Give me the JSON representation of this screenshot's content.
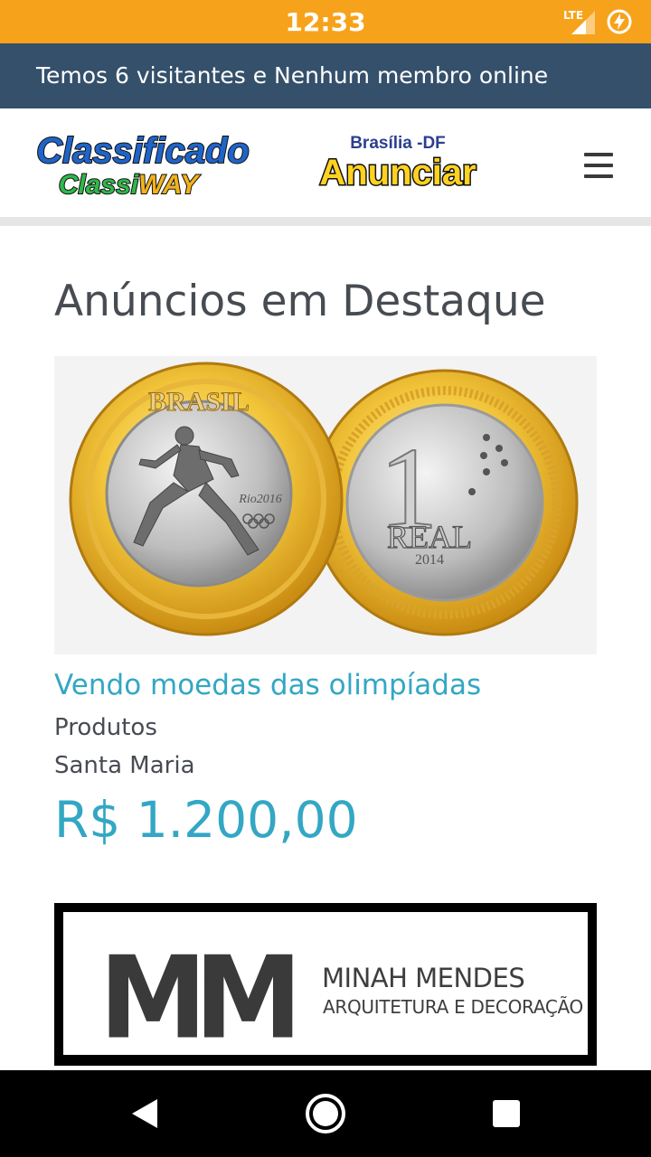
{
  "status_bar": {
    "time": "12:33",
    "network": "LTE",
    "icons": [
      "lte-signal-icon",
      "battery-charging-icon"
    ],
    "color": "#f7a21b"
  },
  "visitors": {
    "text": "Temos 6 visitantes e Nenhum membro online",
    "color": "#34506b"
  },
  "header": {
    "logo_line1": "Classificado",
    "logo_line2_a": "Classi",
    "logo_line2_b": "WAY",
    "anunciar_subtitle": "Brasília -DF",
    "anunciar_label": "Anunciar",
    "menu_icon": "hamburger-menu-icon"
  },
  "main": {
    "section_title": "Anúncios em Destaque",
    "ad": {
      "title": "Vendo moedas das olimpíadas",
      "category": "Produtos",
      "location": "Santa Maria",
      "price": "R$ 1.200,00",
      "image": {
        "coin_left_text": "BRASIL",
        "coin_left_logo": "Rio2016",
        "coin_right_value": "1",
        "coin_right_text": "REAL",
        "coin_right_year": "2014"
      }
    }
  },
  "sponsor": {
    "monogram": "MM",
    "name": "MINAH MENDES",
    "tagline": "ARQUITETURA E DECORAÇÃO"
  },
  "nav_bar": {
    "icons": [
      "back-icon",
      "home-icon",
      "recents-icon"
    ]
  },
  "colors": {
    "accent": "#33a7c4",
    "text": "#474b52"
  }
}
